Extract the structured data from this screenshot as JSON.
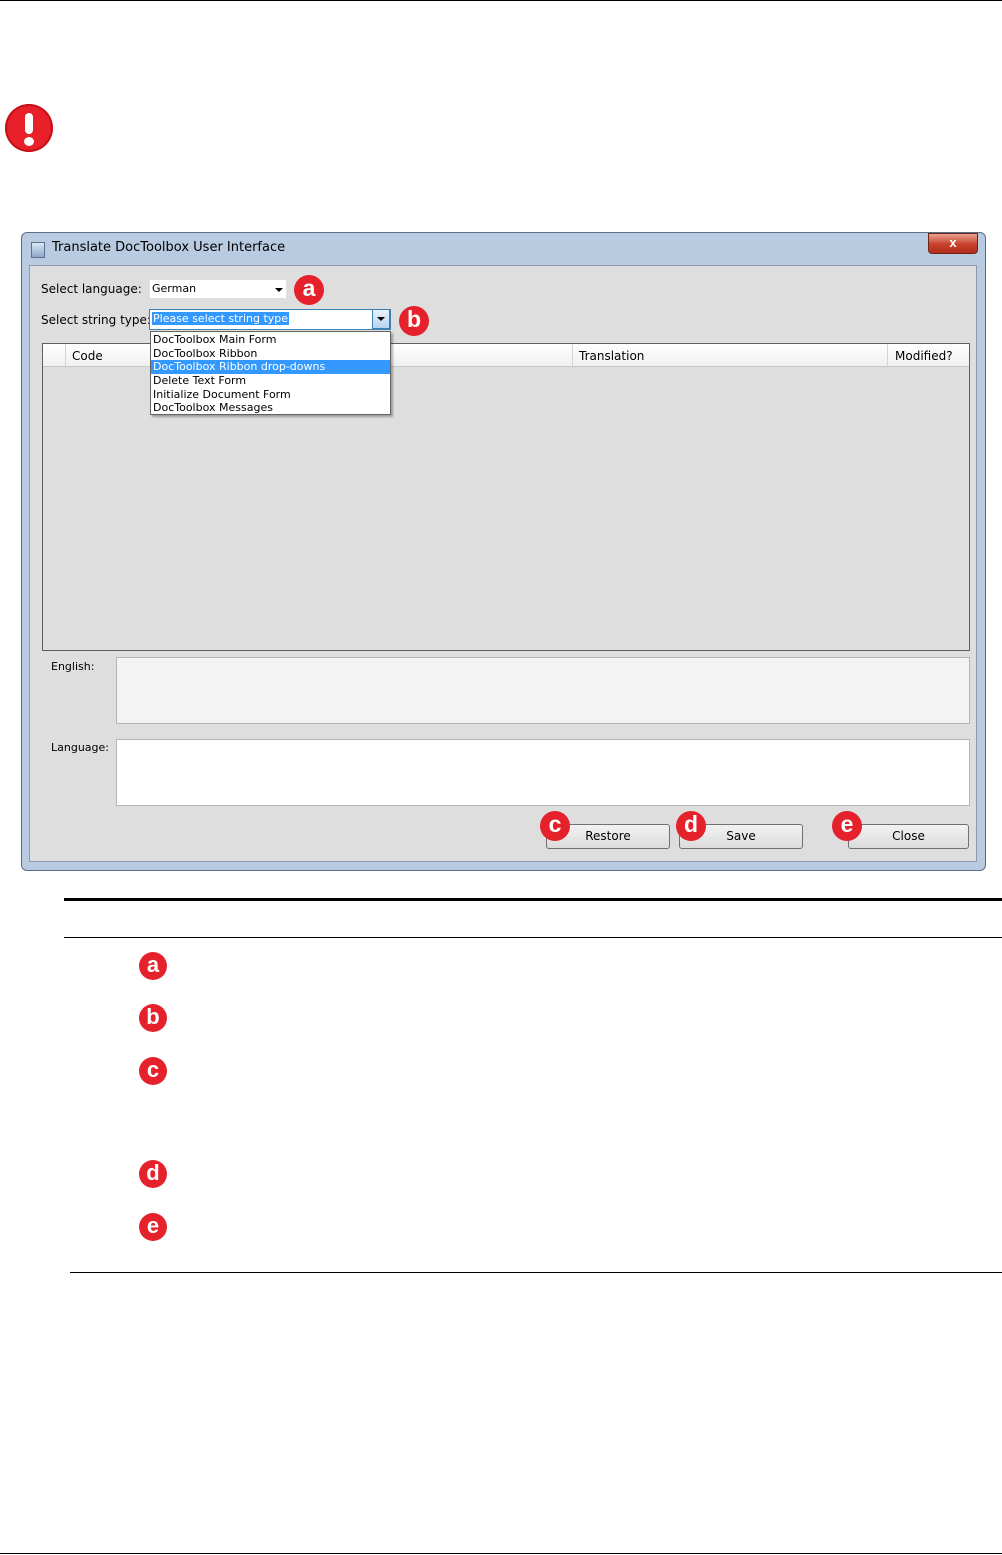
{
  "window": {
    "title": "Translate DocToolbox User Interface",
    "close_glyph": "x"
  },
  "form": {
    "language_label": "Select language:",
    "language_value": "German",
    "string_type_label": "Select string type:",
    "string_type_value": "Please select string type",
    "dropdown_options": [
      "DocToolbox Main Form",
      "DocToolbox Ribbon",
      "DocToolbox Ribbon drop-downs",
      "Delete Text Form",
      "Initialize Document Form",
      "DocToolbox Messages"
    ],
    "highlighted_option": "DocToolbox Ribbon drop-downs"
  },
  "grid": {
    "columns": [
      "Code",
      "Translation",
      "Modified?"
    ]
  },
  "fields": {
    "english_label": "English:",
    "language_label": "Language:"
  },
  "buttons": {
    "restore": "Restore",
    "save": "Save",
    "close": "Close"
  },
  "callouts": {
    "a": "a",
    "b": "b",
    "c": "c",
    "d": "d",
    "e": "e"
  },
  "colors": {
    "callout": "#e5212b",
    "selection": "#3399ff",
    "window_frame": "#b9cbe0"
  }
}
